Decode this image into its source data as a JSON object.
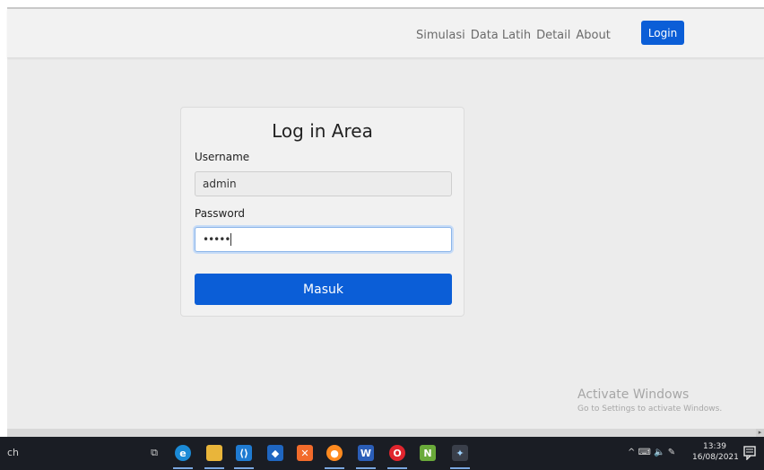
{
  "navbar": {
    "links": [
      "Simulasi",
      "Data Latih",
      "Detail",
      "About"
    ],
    "login_label": "Login"
  },
  "login_card": {
    "title": "Log in Area",
    "username_label": "Username",
    "username_value": "admin",
    "password_label": "Password",
    "password_value": "•••••",
    "submit_label": "Masuk"
  },
  "watermark": {
    "title": "Activate Windows",
    "subtitle": "Go to Settings to activate Windows."
  },
  "taskbar": {
    "search_text": "ch",
    "apps": [
      "task-view-icon",
      "edge-icon",
      "file-explorer-icon",
      "vscode-icon",
      "virtualbox-icon",
      "xampp-icon",
      "firefox-icon",
      "word-icon",
      "opera-icon",
      "notepadpp-icon",
      "wifi-tool-icon"
    ],
    "tray_text": "^ ⌨ 🔈 ✎",
    "time": "13:39",
    "date": "16/08/2021"
  },
  "colors": {
    "primary": "#0b5ed7",
    "background": "#ececec",
    "taskbar": "#1a1d24"
  }
}
